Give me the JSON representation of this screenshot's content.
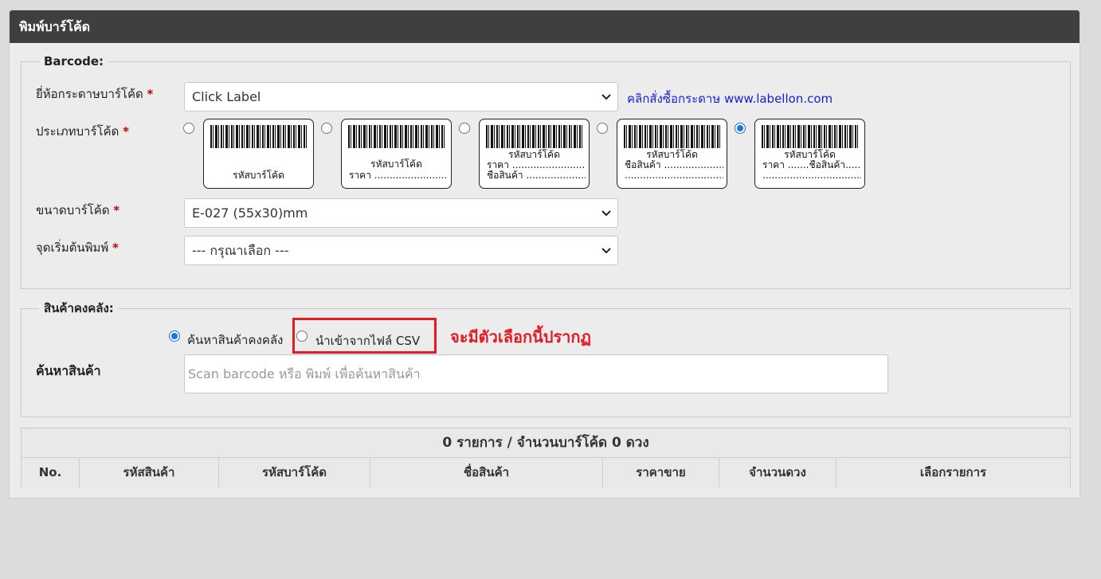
{
  "panel": {
    "title": "พิมพ์บาร์โค้ด"
  },
  "barcode_section": {
    "legend": "Barcode:",
    "paper_brand": {
      "label": "ยี่ห้อกระดาษบาร์โค้ด",
      "required_mark": "*",
      "value": "Click Label"
    },
    "order_link": "คลิกสั่งซื้อกระดาษ www.labellon.com",
    "barcode_type": {
      "label": "ประเภทบาร์โค้ด",
      "required_mark": "*",
      "selected_index": 4,
      "options": [
        {
          "lines": [
            "รหัสบาร์โค้ด"
          ]
        },
        {
          "lines": [
            "รหัสบาร์โค้ด",
            "ราคา ..............................."
          ]
        },
        {
          "lines": [
            "รหัสบาร์โค้ด",
            "ราคา ..............................",
            "ชื่อสินค้า ......................."
          ]
        },
        {
          "lines": [
            "รหัสบาร์โค้ด",
            "ชื่อสินค้า .........................",
            "......................................."
          ]
        },
        {
          "lines": [
            "รหัสบาร์โค้ด",
            "ราคา .......ชื่อสินค้า.......",
            "......................................."
          ]
        }
      ]
    },
    "barcode_size": {
      "label": "ขนาดบาร์โค้ด",
      "required_mark": "*",
      "value": "E-027 (55x30)mm"
    },
    "start_position": {
      "label": "จุดเริ่มต้นพิมพ์",
      "required_mark": "*",
      "value": "--- กรุณาเลือก ---"
    }
  },
  "stock_section": {
    "legend": "สินค้าคงคลัง:",
    "option_search": "ค้นหาสินค้าคงคลัง",
    "option_csv": "นำเข้าจากไฟล์ CSV",
    "note": "จะมีตัวเลือกนี้ปรากฏ",
    "search_label": "ค้นหาสินค้า",
    "search_placeholder": "Scan barcode หรือ พิมพ์ เพื่อค้นหาสินค้า"
  },
  "table": {
    "summary": "0 รายการ / จำนวนบาร์โค้ด 0 ดวง",
    "columns": [
      "No.",
      "รหัสสินค้า",
      "รหัสบาร์โค้ด",
      "ชื่อสินค้า",
      "ราคาขาย",
      "จำนวนดวง",
      "เลือกรายการ"
    ]
  },
  "colors": {
    "header_bg": "#3f3f3f",
    "highlight": "#e31b23",
    "link": "#1a1ad6",
    "radio_on": "#1a73e8"
  }
}
